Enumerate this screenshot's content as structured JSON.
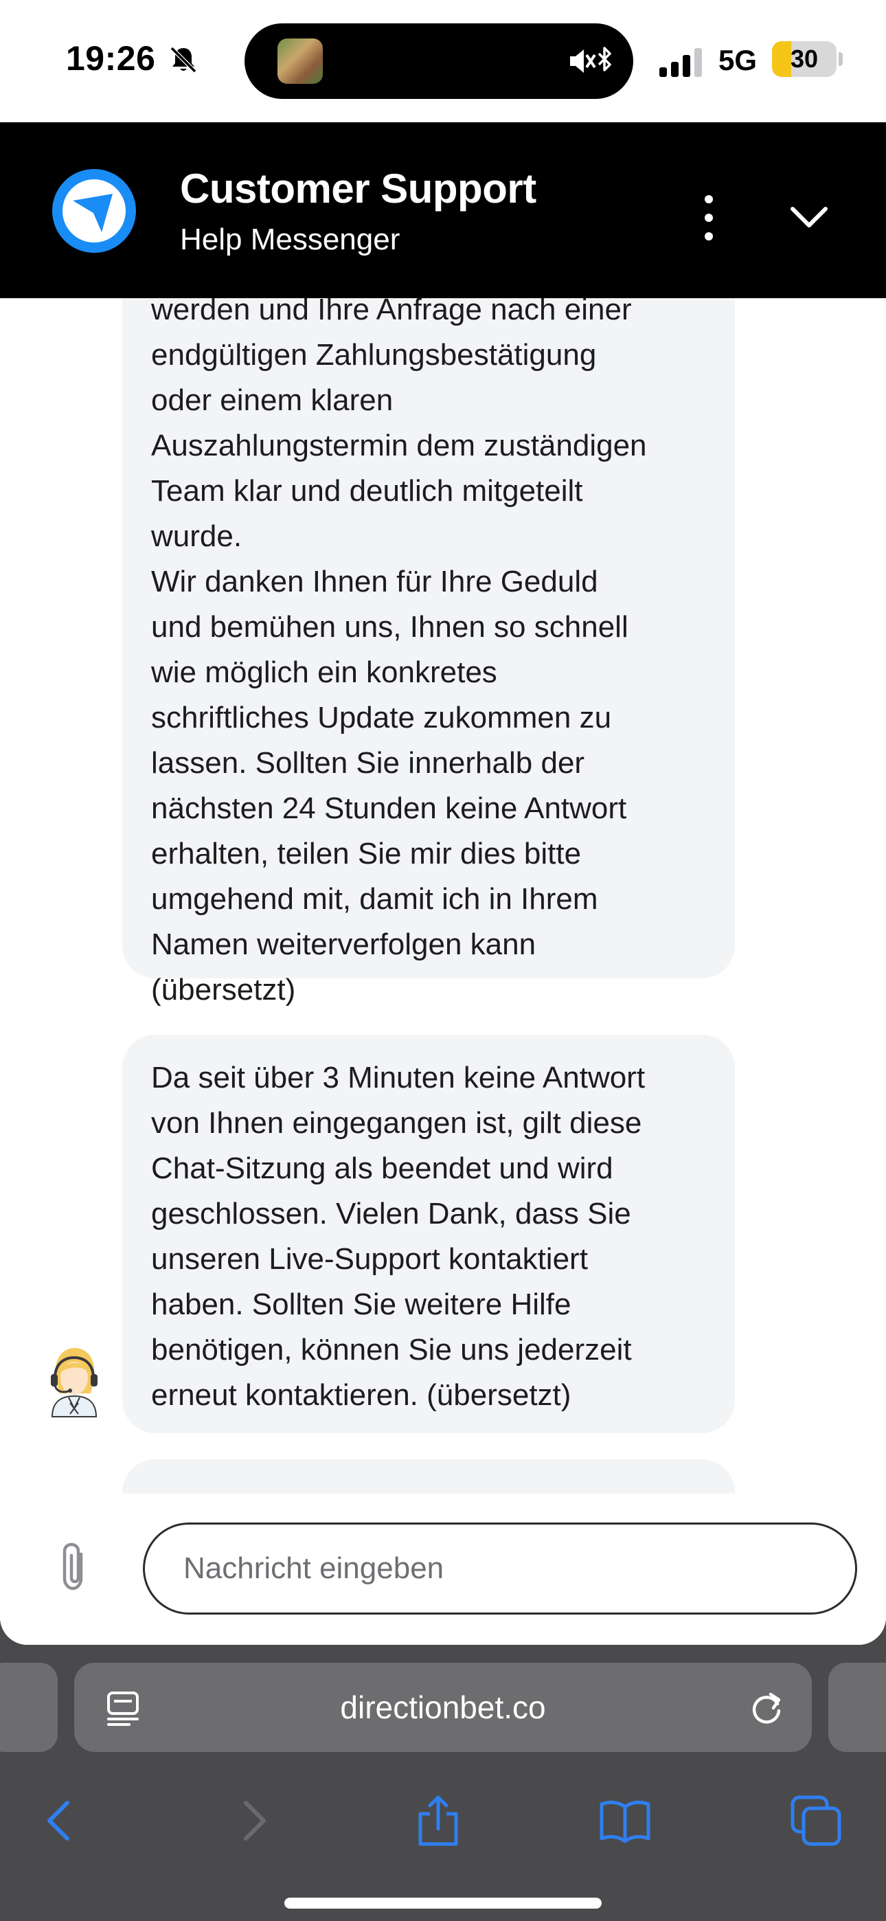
{
  "status_bar": {
    "time": "19:26",
    "network": "5G",
    "battery": "30",
    "battery_level_percent": 30,
    "battery_color": "#f5c518"
  },
  "chat": {
    "title": "Customer Support",
    "subtitle": "Help Messenger",
    "brand_color": "#1a8cf5",
    "messages": [
      {
        "sender": "agent",
        "text": "werden und Ihre Anfrage nach einer\nendgültigen Zahlungsbestätigung\noder einem klaren\nAuszahlungstermin dem zuständigen\nTeam klar und deutlich mitgeteilt\nwurde.\nWir danken Ihnen für Ihre Geduld\nund bemühen uns, Ihnen so schnell\nwie möglich ein konkretes\nschriftliches Update zukommen zu\nlassen. Sollten Sie innerhalb der\nnächsten 24 Stunden keine Antwort\nerhalten, teilen Sie mir dies bitte\numgehend mit, damit ich in Ihrem\nNamen weiterverfolgen kann\n(übersetzt)"
      },
      {
        "sender": "agent",
        "text": "Da seit über 3 Minuten keine Antwort\nvon Ihnen eingegangen ist, gilt diese\nChat-Sitzung als beendet und wird\ngeschlossen. Vielen Dank, dass Sie\nunseren Live-Support kontaktiert\nhaben. Sollten Sie weitere Hilfe\nbenötigen, können Sie uns jederzeit\nerneut kontaktieren. (übersetzt)"
      }
    ],
    "composer": {
      "placeholder": "Nachricht eingeben"
    }
  },
  "browser": {
    "url": "directionbet.co",
    "icons": {
      "reader": "reader-icon",
      "reload": "reload-icon",
      "back": "chevron-left-icon",
      "forward": "chevron-right-icon",
      "share": "share-icon",
      "bookmarks": "book-icon",
      "tabs": "tabs-icon"
    }
  }
}
